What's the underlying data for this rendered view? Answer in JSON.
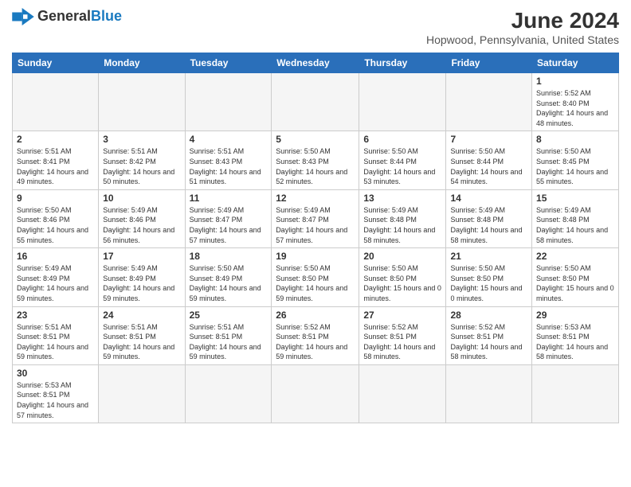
{
  "logo": {
    "text_general": "General",
    "text_blue": "Blue"
  },
  "header": {
    "month": "June 2024",
    "location": "Hopwood, Pennsylvania, United States"
  },
  "weekdays": [
    "Sunday",
    "Monday",
    "Tuesday",
    "Wednesday",
    "Thursday",
    "Friday",
    "Saturday"
  ],
  "weeks": [
    [
      {
        "day": "",
        "empty": true
      },
      {
        "day": "",
        "empty": true
      },
      {
        "day": "",
        "empty": true
      },
      {
        "day": "",
        "empty": true
      },
      {
        "day": "",
        "empty": true
      },
      {
        "day": "",
        "empty": true
      },
      {
        "day": "1",
        "sunrise": "5:52 AM",
        "sunset": "8:40 PM",
        "daylight": "14 hours and 48 minutes."
      }
    ],
    [
      {
        "day": "2",
        "sunrise": "5:51 AM",
        "sunset": "8:41 PM",
        "daylight": "14 hours and 49 minutes."
      },
      {
        "day": "3",
        "sunrise": "5:51 AM",
        "sunset": "8:42 PM",
        "daylight": "14 hours and 50 minutes."
      },
      {
        "day": "4",
        "sunrise": "5:51 AM",
        "sunset": "8:43 PM",
        "daylight": "14 hours and 51 minutes."
      },
      {
        "day": "5",
        "sunrise": "5:50 AM",
        "sunset": "8:43 PM",
        "daylight": "14 hours and 52 minutes."
      },
      {
        "day": "6",
        "sunrise": "5:50 AM",
        "sunset": "8:44 PM",
        "daylight": "14 hours and 53 minutes."
      },
      {
        "day": "7",
        "sunrise": "5:50 AM",
        "sunset": "8:44 PM",
        "daylight": "14 hours and 54 minutes."
      },
      {
        "day": "8",
        "sunrise": "5:50 AM",
        "sunset": "8:45 PM",
        "daylight": "14 hours and 55 minutes."
      }
    ],
    [
      {
        "day": "9",
        "sunrise": "5:50 AM",
        "sunset": "8:46 PM",
        "daylight": "14 hours and 55 minutes."
      },
      {
        "day": "10",
        "sunrise": "5:49 AM",
        "sunset": "8:46 PM",
        "daylight": "14 hours and 56 minutes."
      },
      {
        "day": "11",
        "sunrise": "5:49 AM",
        "sunset": "8:47 PM",
        "daylight": "14 hours and 57 minutes."
      },
      {
        "day": "12",
        "sunrise": "5:49 AM",
        "sunset": "8:47 PM",
        "daylight": "14 hours and 57 minutes."
      },
      {
        "day": "13",
        "sunrise": "5:49 AM",
        "sunset": "8:48 PM",
        "daylight": "14 hours and 58 minutes."
      },
      {
        "day": "14",
        "sunrise": "5:49 AM",
        "sunset": "8:48 PM",
        "daylight": "14 hours and 58 minutes."
      },
      {
        "day": "15",
        "sunrise": "5:49 AM",
        "sunset": "8:48 PM",
        "daylight": "14 hours and 58 minutes."
      }
    ],
    [
      {
        "day": "16",
        "sunrise": "5:49 AM",
        "sunset": "8:49 PM",
        "daylight": "14 hours and 59 minutes."
      },
      {
        "day": "17",
        "sunrise": "5:49 AM",
        "sunset": "8:49 PM",
        "daylight": "14 hours and 59 minutes."
      },
      {
        "day": "18",
        "sunrise": "5:50 AM",
        "sunset": "8:49 PM",
        "daylight": "14 hours and 59 minutes."
      },
      {
        "day": "19",
        "sunrise": "5:50 AM",
        "sunset": "8:50 PM",
        "daylight": "14 hours and 59 minutes."
      },
      {
        "day": "20",
        "sunrise": "5:50 AM",
        "sunset": "8:50 PM",
        "daylight": "15 hours and 0 minutes."
      },
      {
        "day": "21",
        "sunrise": "5:50 AM",
        "sunset": "8:50 PM",
        "daylight": "15 hours and 0 minutes."
      },
      {
        "day": "22",
        "sunrise": "5:50 AM",
        "sunset": "8:50 PM",
        "daylight": "15 hours and 0 minutes."
      }
    ],
    [
      {
        "day": "23",
        "sunrise": "5:51 AM",
        "sunset": "8:51 PM",
        "daylight": "14 hours and 59 minutes."
      },
      {
        "day": "24",
        "sunrise": "5:51 AM",
        "sunset": "8:51 PM",
        "daylight": "14 hours and 59 minutes."
      },
      {
        "day": "25",
        "sunrise": "5:51 AM",
        "sunset": "8:51 PM",
        "daylight": "14 hours and 59 minutes."
      },
      {
        "day": "26",
        "sunrise": "5:52 AM",
        "sunset": "8:51 PM",
        "daylight": "14 hours and 59 minutes."
      },
      {
        "day": "27",
        "sunrise": "5:52 AM",
        "sunset": "8:51 PM",
        "daylight": "14 hours and 58 minutes."
      },
      {
        "day": "28",
        "sunrise": "5:52 AM",
        "sunset": "8:51 PM",
        "daylight": "14 hours and 58 minutes."
      },
      {
        "day": "29",
        "sunrise": "5:53 AM",
        "sunset": "8:51 PM",
        "daylight": "14 hours and 58 minutes."
      }
    ],
    [
      {
        "day": "30",
        "sunrise": "5:53 AM",
        "sunset": "8:51 PM",
        "daylight": "14 hours and 57 minutes."
      },
      {
        "day": "",
        "empty": true
      },
      {
        "day": "",
        "empty": true
      },
      {
        "day": "",
        "empty": true
      },
      {
        "day": "",
        "empty": true
      },
      {
        "day": "",
        "empty": true
      },
      {
        "day": "",
        "empty": true
      }
    ]
  ]
}
